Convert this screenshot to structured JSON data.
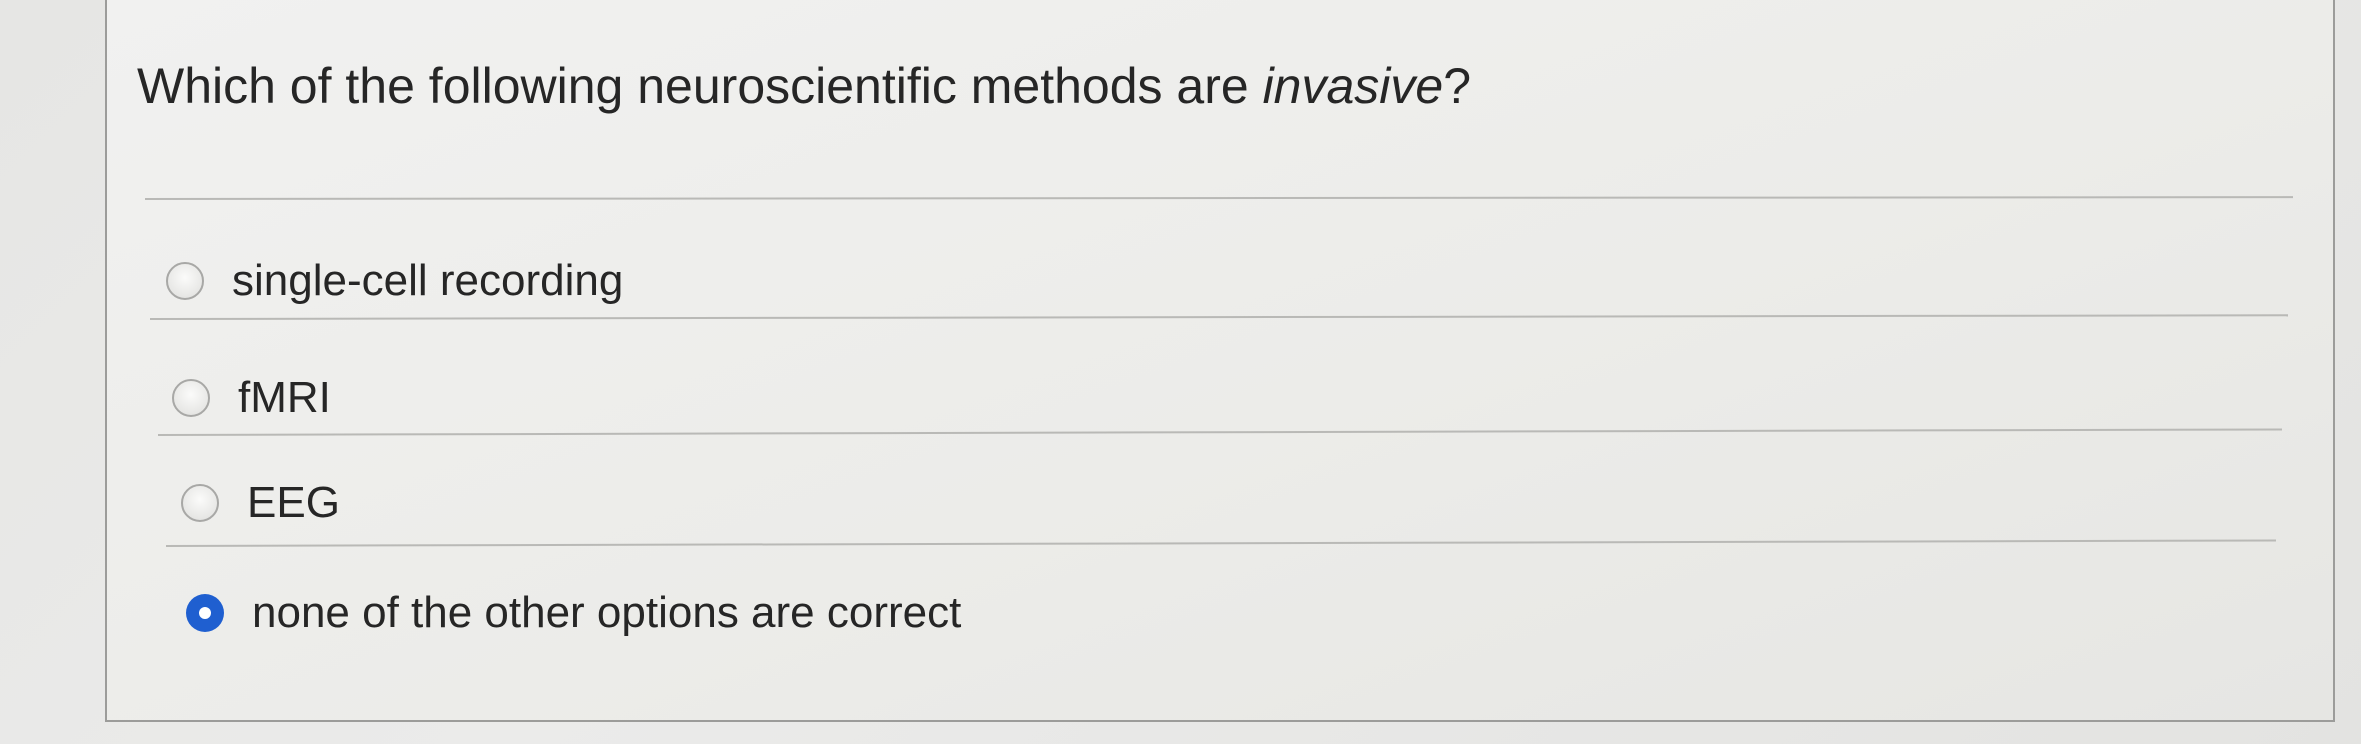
{
  "question": {
    "prefix": "Which of the following neuroscientific methods are ",
    "emphasis": "invasive",
    "suffix": "?"
  },
  "options": [
    {
      "label": "single-cell recording",
      "selected": false
    },
    {
      "label": "fMRI",
      "selected": false
    },
    {
      "label": "EEG",
      "selected": false
    },
    {
      "label": "none of the other options are correct",
      "selected": true
    }
  ],
  "colors": {
    "selected_radio": "#1f5fd0",
    "text": "#262626",
    "rule": "#b9b9b6"
  }
}
